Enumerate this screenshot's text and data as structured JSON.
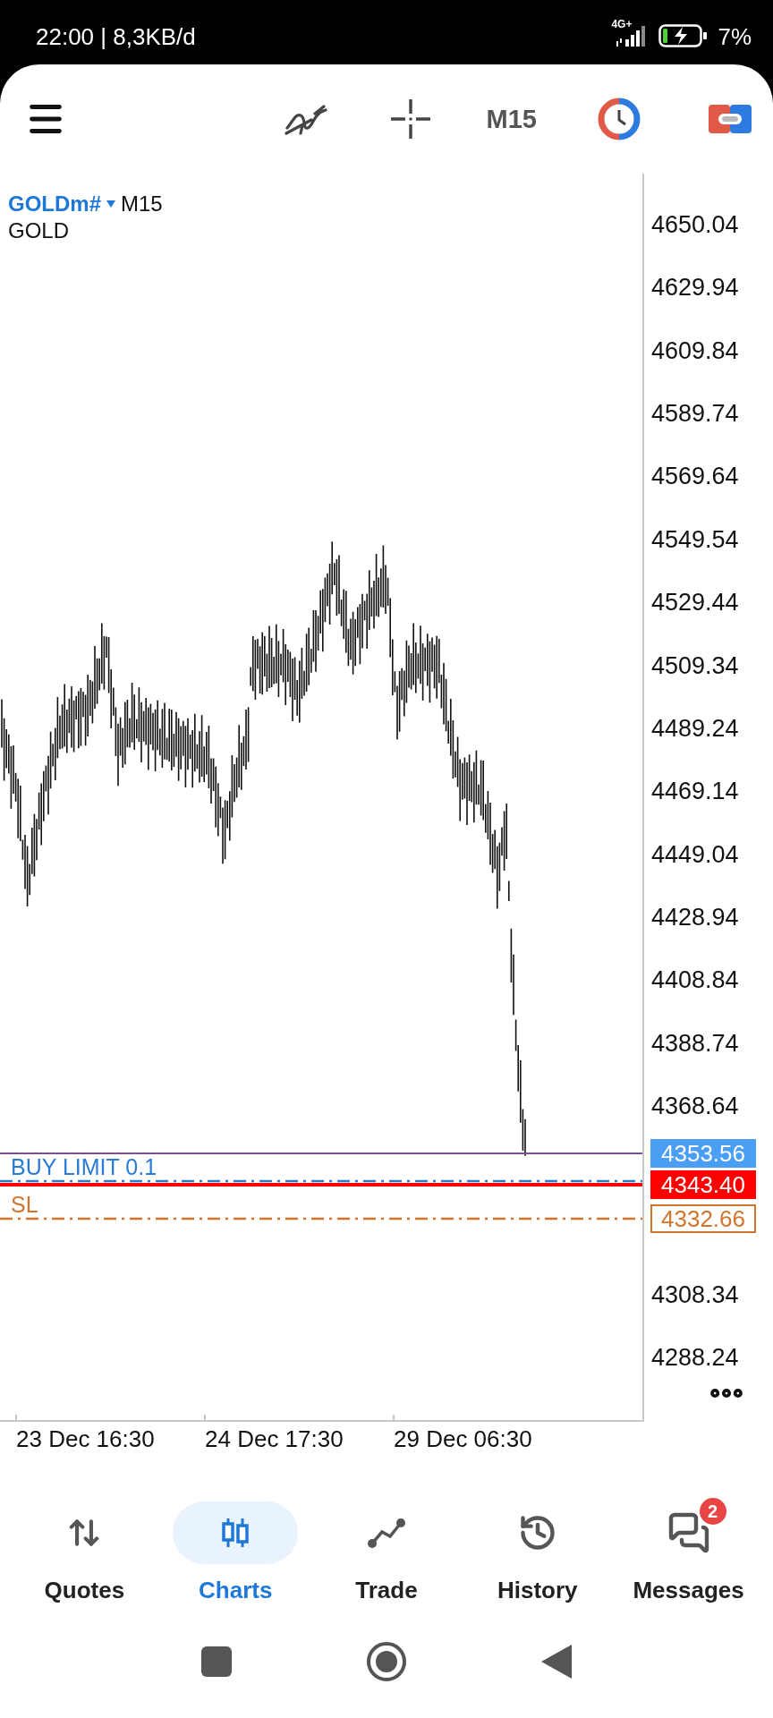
{
  "status_bar": {
    "time": "22:00 | 8,3KB/d",
    "network": "4G+",
    "battery": "7%"
  },
  "toolbar": {
    "timeframe": "M15"
  },
  "chart": {
    "symbol": "GOLDm#",
    "timeframe": "M15",
    "description": "GOLD",
    "price_labels": [
      "4650.04",
      "4629.94",
      "4609.84",
      "4589.74",
      "4569.64",
      "4549.54",
      "4529.44",
      "4509.34",
      "4489.24",
      "4469.14",
      "4449.04",
      "4428.94",
      "4408.84",
      "4388.74",
      "4368.64",
      "4308.34",
      "4288.24"
    ],
    "time_labels": [
      "23 Dec 16:30",
      "24 Dec 17:30",
      "29 Dec 06:30"
    ],
    "lines": [
      {
        "kind": "price",
        "tag": "4353.56",
        "color": "#4a9ff5"
      },
      {
        "kind": "ask",
        "tag": "4343.40",
        "color": "#ff0000"
      },
      {
        "kind": "stop",
        "label": "SL",
        "tag": "4332.66",
        "color": "#d2742b"
      }
    ],
    "order": {
      "label": "BUY LIMIT 0.1",
      "color": "#2a7bd6"
    }
  },
  "nav": [
    {
      "label": "Quotes",
      "selected": false
    },
    {
      "label": "Charts",
      "selected": true
    },
    {
      "label": "Trade",
      "selected": false
    },
    {
      "label": "History",
      "selected": false
    },
    {
      "label": "Messages",
      "selected": false,
      "badge": "2"
    }
  ]
}
